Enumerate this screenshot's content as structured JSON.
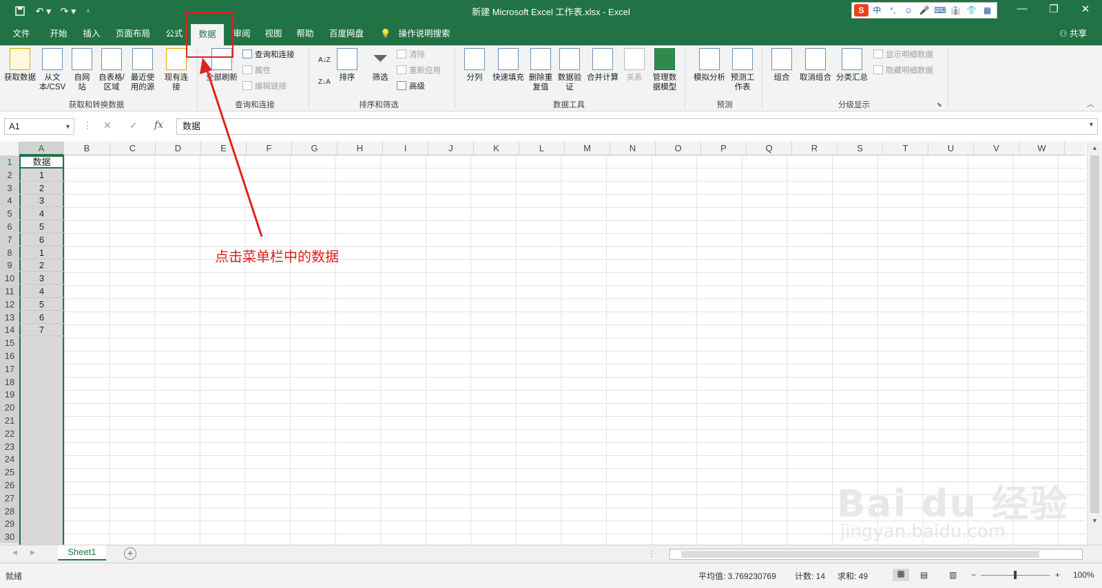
{
  "window": {
    "title": "新建 Microsoft Excel 工作表.xlsx  -  Excel"
  },
  "quick_access": {
    "save_icon": "save-icon",
    "undo_icon": "undo-icon",
    "redo_icon": "redo-icon",
    "customize_icon": "customize-icon"
  },
  "ime": {
    "items": [
      "S",
      "中",
      "°,",
      "☺",
      "🎤",
      "⌨",
      "👔",
      "👕",
      "▦"
    ]
  },
  "tabs": [
    "文件",
    "开始",
    "插入",
    "页面布局",
    "公式",
    "数据",
    "审阅",
    "视图",
    "帮助",
    "百度网盘",
    "操作说明搜索"
  ],
  "active_tab": "数据",
  "share_label": "共享",
  "ribbon": {
    "groups": {
      "get_transform": "获取和转换数据",
      "queries": "查询和连接",
      "sort_filter": "排序和筛选",
      "data_tools": "数据工具",
      "forecast": "预测",
      "outline": "分级显示"
    },
    "buttons": {
      "get_data": "获取数据",
      "from_text": "从文本/CSV",
      "from_web": "自网站",
      "from_table": "自表格/区域",
      "recent_sources": "最近使用的源",
      "existing_conn": "现有连接",
      "refresh_all": "全部刷新",
      "queries_conn": "查询和连接",
      "properties": "属性",
      "edit_links": "编辑链接",
      "sort": "排序",
      "filter": "筛选",
      "clear": "清除",
      "reapply": "重新应用",
      "advanced": "高级",
      "text_to_cols": "分列",
      "flash_fill": "快速填充",
      "remove_dup": "删除重复值",
      "validation": "数据验证",
      "consolidate": "合并计算",
      "relations": "关系",
      "data_model": "管理数据模型",
      "what_if": "模拟分析",
      "forecast_sheet": "预测工作表",
      "group": "组合",
      "ungroup": "取消组合",
      "subtotal": "分类汇总",
      "show_detail": "显示明细数据",
      "hide_detail": "隐藏明细数据"
    }
  },
  "formula_bar": {
    "name_box": "A1",
    "cancel": "✕",
    "enter": "✓",
    "fx": "fx",
    "value": "数据"
  },
  "columns": [
    "A",
    "B",
    "C",
    "D",
    "E",
    "F",
    "G",
    "H",
    "I",
    "J",
    "K",
    "L",
    "M",
    "N",
    "O",
    "P",
    "Q",
    "R",
    "S",
    "T",
    "U",
    "V",
    "W"
  ],
  "rows": [
    "1",
    "2",
    "3",
    "4",
    "5",
    "6",
    "7",
    "8",
    "9",
    "10",
    "11",
    "12",
    "13",
    "14",
    "15",
    "16",
    "17",
    "18",
    "19",
    "20",
    "21",
    "22",
    "23",
    "24",
    "25",
    "26",
    "27",
    "28",
    "29",
    "30"
  ],
  "column_a": [
    "数据",
    "1",
    "2",
    "3",
    "4",
    "5",
    "6",
    "1",
    "2",
    "3",
    "4",
    "5",
    "6",
    "7"
  ],
  "sheet_tab": "Sheet1",
  "status": {
    "ready": "就绪",
    "average": "平均值: 3.769230769",
    "count": "计数: 14",
    "sum": "求和: 49",
    "zoom": "100%"
  },
  "annotation": {
    "text": "点击菜单栏中的数据",
    "color": "#e02020"
  },
  "watermark": {
    "logo": "Bai du 经验",
    "url": "jingyan.baidu.com"
  },
  "colors": {
    "accent": "#217346",
    "ribbon": "#f3f3f3"
  }
}
